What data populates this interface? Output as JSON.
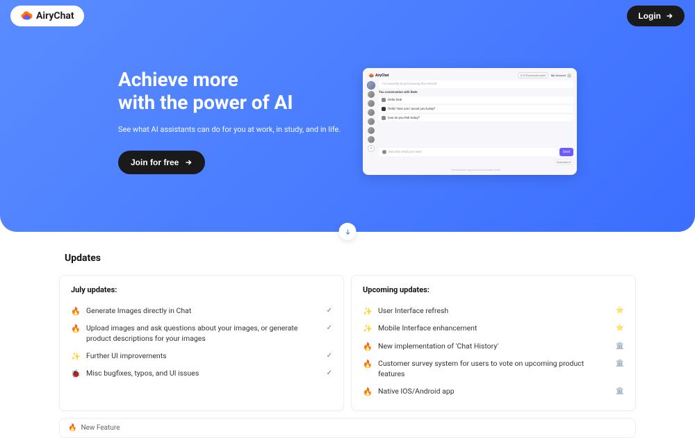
{
  "brand": {
    "name": "AiryChat"
  },
  "header": {
    "login_label": "Login"
  },
  "hero": {
    "title_line1": "Achieve more",
    "title_line2": "with the power of AI",
    "subtitle": "See what AI assistants can do for you at work, in study, and in life.",
    "cta_label": "Join for free"
  },
  "preview": {
    "trial_text": "0 of 5 prompts used",
    "account_label": "My Account",
    "search_placeholder": "I'm currently busy browsing the internet.",
    "convo_label": "You conversation with Ibele",
    "msg1": "Hello ibob",
    "msg2": "Hello! How can I assist you today?",
    "msg3": "how do you feel today?",
    "input_placeholder": "describe what you need",
    "send_label": "Send",
    "examples_label": "Examples ▾",
    "footer_text": "This assistant may produce inaccurate results."
  },
  "updates": {
    "section_title": "Updates",
    "july_title": "July updates:",
    "upcoming_title": "Upcoming updates:",
    "july_items": [
      {
        "leading": "🔥",
        "text": "Generate Images directly in Chat",
        "trailing": "✓"
      },
      {
        "leading": "🔥",
        "text": "Upload images and ask questions about your images, or generate product descriptions for your images",
        "trailing": "✓"
      },
      {
        "leading": "✨",
        "text": "Further UI improvements",
        "trailing": "✓"
      },
      {
        "leading": "🐞",
        "text": "Misc bugfixes, typos, and UI issues",
        "trailing": "✓"
      }
    ],
    "upcoming_items": [
      {
        "leading": "✨",
        "text": "User Interface refresh",
        "trailing": "⭐"
      },
      {
        "leading": "✨",
        "text": "Mobile Interface enhancement",
        "trailing": "⭐"
      },
      {
        "leading": "🔥",
        "text": "New implementation of 'Chat History'",
        "trailing": "🏛️"
      },
      {
        "leading": "🔥",
        "text": "Customer survey system for users to vote on upcoming product features",
        "trailing": "🏛️"
      },
      {
        "leading": "🔥",
        "text": "Native IOS/Android app",
        "trailing": "🏛️"
      }
    ],
    "new_feature_label": "New Feature"
  }
}
